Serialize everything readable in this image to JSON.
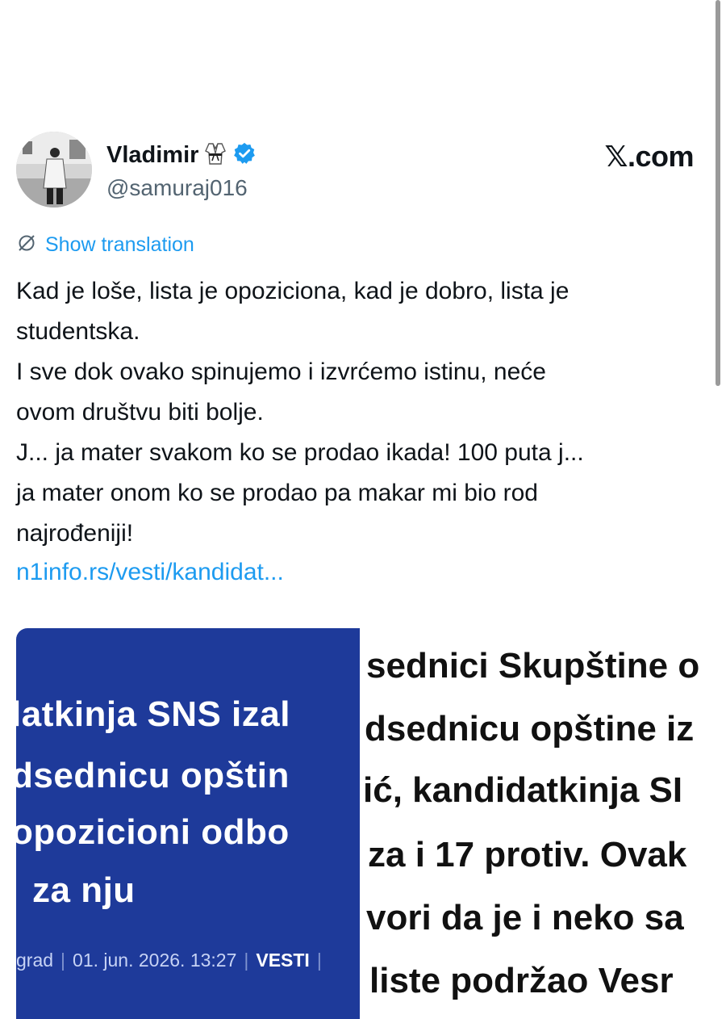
{
  "tweet": {
    "author": {
      "display_name": "Vladimir",
      "handle": "@samuraj016",
      "emoji_icon": "martial-arts-uniform-icon",
      "verified_icon": "verified-badge-icon"
    },
    "brand": "𝕏.com",
    "show_translation_label": "Show translation",
    "text_lines": [
      "Kad je loše, lista je opoziciona, kad je dobro, lista je",
      "studentska.",
      "I sve dok ovako spinujemo i izvrćemo istinu, neće",
      "ovom društvu biti bolje.",
      "J... ja mater svakom ko se prodao ikada! 100 puta j...",
      "ja mater onom ko se prodao pa makar mi bio rod",
      "najrođeniji!"
    ],
    "link": "n1info.rs/vesti/kandidat..."
  },
  "card": {
    "headline_lines": [
      "latkinja SNS izal",
      "dsednicu opštin",
      "opozicioni odbo",
      "za nju"
    ],
    "meta": {
      "location": "grad",
      "date": "01. jun. 2026. 13:27",
      "section": "VESTI"
    },
    "body_lines": [
      "sednici Skupštine o",
      "dsednicu opštine iz",
      "ić, kandidatkinja SI",
      "za i 17 protiv. Ovak",
      "vori da je i neko sa",
      "liste podržao Vesr"
    ]
  },
  "colors": {
    "link_blue": "#1d9bf0",
    "verified_blue": "#1d9bf0",
    "card_blue": "#1e3a9a"
  }
}
